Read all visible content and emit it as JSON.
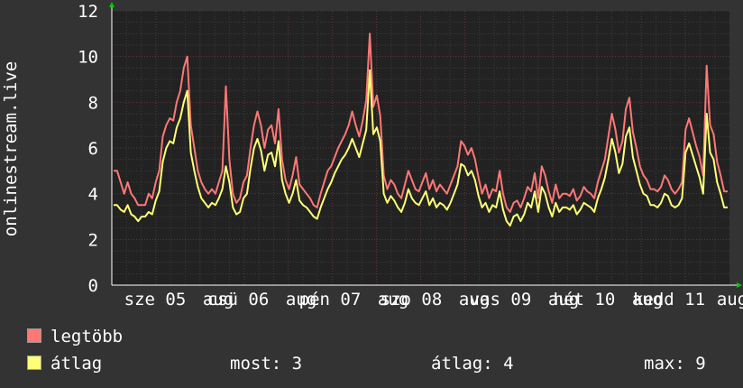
{
  "chart_data": {
    "type": "line",
    "ylabel": "onlinestream.live",
    "ylim": [
      0,
      12
    ],
    "yticks": [
      0,
      2,
      4,
      6,
      8,
      10,
      12
    ],
    "x_tick_labels": [
      "sze 05",
      "aug",
      "csü 06",
      "aug",
      "pén 07",
      "aug",
      "szo 08",
      "aug",
      "vas 09",
      "aug",
      "hét 10",
      "aug",
      "kedd 11",
      "aug"
    ],
    "grid": true,
    "series": [
      {
        "name": "legtöbb",
        "color": "#ff7777",
        "values": [
          5,
          5,
          4.5,
          4,
          4.5,
          4,
          3.8,
          3.5,
          3.5,
          3.5,
          4,
          3.8,
          4.5,
          5,
          6.5,
          7,
          7.3,
          7.2,
          8,
          8.5,
          9.5,
          10,
          7,
          6,
          5,
          4.5,
          4.2,
          4,
          4.2,
          4,
          4.5,
          5,
          8.7,
          5.5,
          4,
          3.6,
          3.8,
          4.5,
          4.8,
          6,
          7,
          7.6,
          7,
          6,
          6.8,
          7,
          6.2,
          7.7,
          5.5,
          4.6,
          4.2,
          4.8,
          5.6,
          4.4,
          4.2,
          4,
          3.8,
          3.5,
          3.4,
          4,
          4.5,
          5,
          5.2,
          5.6,
          6,
          6.3,
          6.6,
          7,
          7.6,
          7,
          6.5,
          7.2,
          8.1,
          11,
          7.8,
          8.3,
          7.4,
          4.8,
          4.2,
          4.6,
          4.4,
          4,
          3.8,
          4.4,
          5,
          4.6,
          4.2,
          4.1,
          4.5,
          4.9,
          4.2,
          4.6,
          4.1,
          4.4,
          4.2,
          4,
          4.4,
          4.8,
          5.2,
          6.3,
          6.1,
          5.7,
          6,
          5.5,
          4.7,
          4,
          4.4,
          3.8,
          4.2,
          4.1,
          5,
          4,
          3.4,
          3.2,
          3.6,
          3.7,
          3.4,
          3.8,
          4.3,
          4.1,
          4.9,
          3.8,
          5.2,
          4.8,
          4.1,
          3.6,
          4.4,
          3.8,
          4,
          4,
          3.9,
          4.2,
          3.7,
          3.9,
          4.3,
          4.1,
          4,
          3.8,
          4.5,
          5,
          5.5,
          6.5,
          7.5,
          6.8,
          5.8,
          6.3,
          7.7,
          8.2,
          6.7,
          6,
          5.2,
          4.8,
          4.6,
          4.2,
          4.2,
          4.1,
          4.3,
          4.8,
          4.6,
          4.2,
          4,
          4.2,
          4.5,
          6.8,
          7.3,
          6.7,
          6.1,
          5.6,
          4.8,
          9.6,
          7,
          6.6,
          5.4,
          4.8,
          4.1,
          4.1
        ]
      },
      {
        "name": "átlag",
        "color": "#ffff77",
        "values": [
          3.5,
          3.5,
          3.3,
          3.2,
          3.5,
          3.1,
          3,
          2.8,
          3,
          3,
          3.2,
          3.1,
          3.7,
          4.1,
          5.4,
          6,
          6.3,
          6.2,
          6.9,
          7.3,
          8,
          8.5,
          5.8,
          5,
          4.3,
          3.8,
          3.6,
          3.4,
          3.6,
          3.5,
          3.8,
          4.2,
          5.2,
          4.5,
          3.4,
          3.1,
          3.2,
          3.8,
          4,
          5.1,
          6,
          6.4,
          5.9,
          5,
          5.7,
          5.8,
          5.2,
          6.3,
          4.6,
          4,
          3.6,
          4,
          4.6,
          3.7,
          3.5,
          3.4,
          3.2,
          3,
          2.9,
          3.4,
          3.8,
          4.2,
          4.5,
          4.9,
          5.2,
          5.5,
          5.7,
          6,
          6.4,
          6,
          5.6,
          6.2,
          6.8,
          9.4,
          6.6,
          6.9,
          6.3,
          4,
          3.6,
          3.9,
          3.7,
          3.4,
          3.2,
          3.6,
          4.2,
          3.8,
          3.6,
          3.5,
          3.8,
          4.1,
          3.5,
          3.8,
          3.4,
          3.6,
          3.5,
          3.3,
          3.6,
          4,
          4.4,
          5.3,
          5.2,
          4.8,
          5,
          4.6,
          3.9,
          3.4,
          3.6,
          3.2,
          3.5,
          3.4,
          4.1,
          3.3,
          2.8,
          2.6,
          3,
          3.1,
          2.8,
          3.1,
          3.6,
          3.4,
          4.1,
          3.2,
          4.3,
          4,
          3.4,
          3,
          3.6,
          3.2,
          3.4,
          3.4,
          3.3,
          3.5,
          3.1,
          3.3,
          3.6,
          3.5,
          3.4,
          3.2,
          3.8,
          4.2,
          4.7,
          5.5,
          6.4,
          5.8,
          4.9,
          5.3,
          6.5,
          6.9,
          5.6,
          5,
          4.4,
          4,
          3.9,
          3.5,
          3.5,
          3.4,
          3.6,
          4,
          3.9,
          3.5,
          3.4,
          3.5,
          3.8,
          5.8,
          6.2,
          5.7,
          5.2,
          4.7,
          4,
          7.5,
          5.8,
          5.5,
          4.5,
          4,
          3.4,
          3.4
        ]
      }
    ]
  },
  "legend": {
    "items": [
      {
        "label": "legtöbb",
        "color": "#ff7777"
      },
      {
        "label": "átlag",
        "color": "#ffff77"
      }
    ],
    "stats": {
      "now": "most: 3",
      "avg": "átlag: 4",
      "max": "max: 9"
    }
  }
}
